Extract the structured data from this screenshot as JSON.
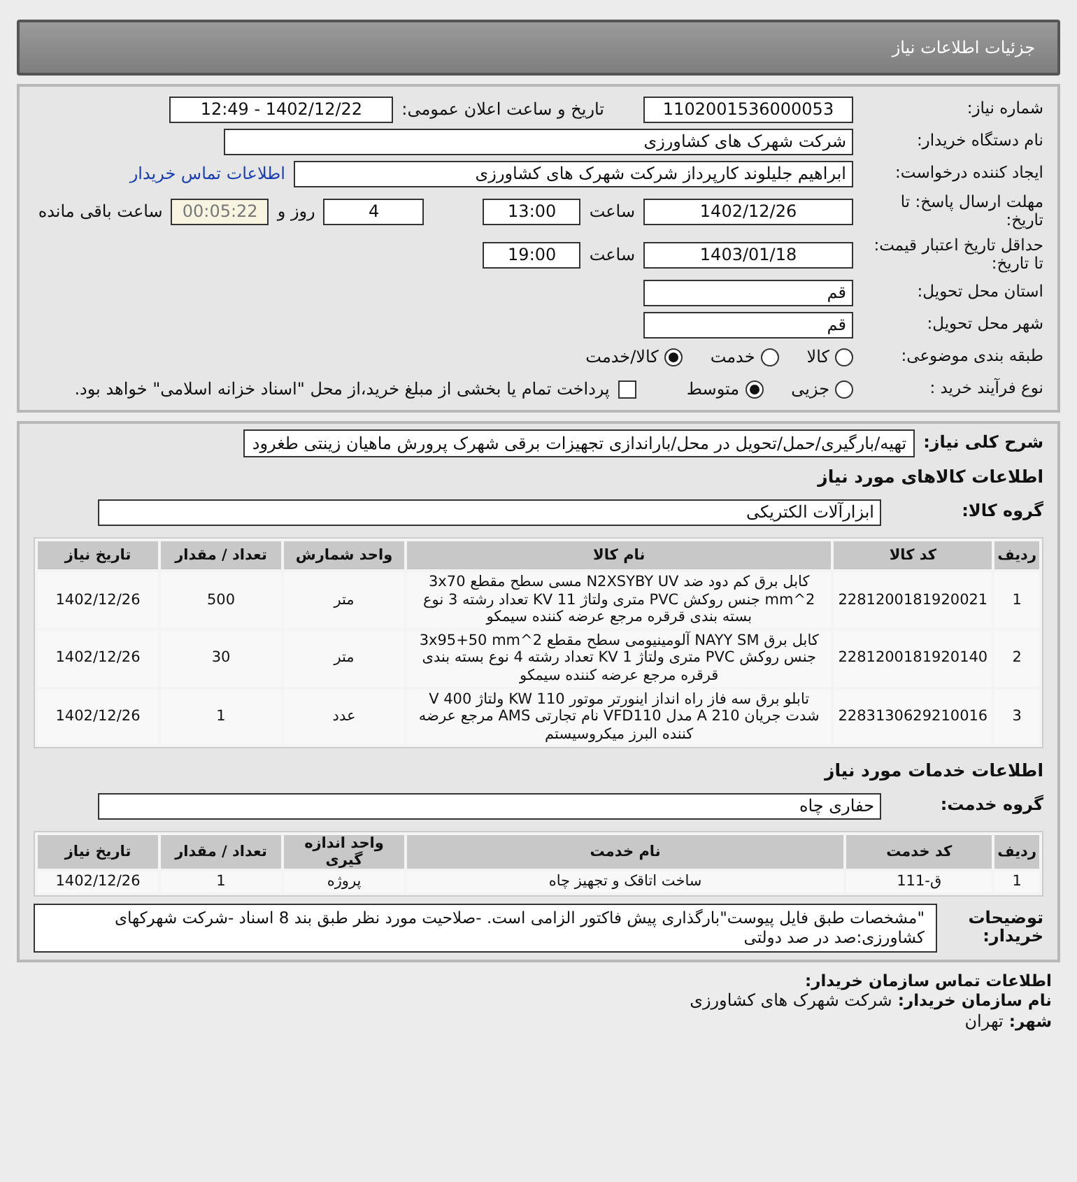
{
  "header": {
    "title": "جزئیات اطلاعات نیاز"
  },
  "need_info": {
    "need_number": {
      "label": "شماره نیاز:",
      "value": "1102001536000053"
    },
    "announce": {
      "label": "تاریخ و ساعت اعلان عمومی:",
      "value": "1402/12/22 - 12:49"
    },
    "buyer": {
      "label": "نام دستگاه خریدار:",
      "value": "شرکت شهرک های کشاورزی"
    },
    "requester": {
      "label": "ایجاد کننده درخواست:",
      "value": "ابراهیم جلیلوند کارپرداز شرکت شهرک های کشاورزی",
      "link": "اطلاعات تماس خریدار"
    },
    "deadline": {
      "label": "مهلت ارسال پاسخ: تا تاریخ:",
      "date": "1402/12/26",
      "time_label": "ساعت",
      "time": "13:00",
      "days": "4",
      "days_label": "روز و",
      "remaining": "00:05:22",
      "remaining_label": "ساعت باقی مانده"
    },
    "validity": {
      "label": "حداقل تاریخ اعتبار قیمت: تا تاریخ:",
      "date": "1403/01/18",
      "time_label": "ساعت",
      "time": "19:00"
    },
    "province": {
      "label": "استان محل تحویل:",
      "value": "قم"
    },
    "city": {
      "label": "شهر محل تحویل:",
      "value": "قم"
    },
    "category": {
      "label": "طبقه بندی موضوعی:",
      "options": [
        {
          "label": "کالا",
          "selected": false
        },
        {
          "label": "خدمت",
          "selected": false
        },
        {
          "label": "کالا/خدمت",
          "selected": true
        }
      ]
    },
    "purchase_process": {
      "label": "نوع فرآیند خرید :",
      "options": [
        {
          "label": "جزیی",
          "selected": false
        },
        {
          "label": "متوسط",
          "selected": true
        }
      ],
      "payment": {
        "label": "پرداخت تمام یا بخشی از مبلغ خرید،از محل \"اسناد خزانه اسلامی\" خواهد بود.",
        "checked": false
      }
    }
  },
  "details": {
    "description": {
      "label": "شرح کلی نیاز:",
      "value": "تهیه/بارگیری/حمل/تحویل در محل/باراندازی تجهیزات برقی شهرک پرورش ماهیان زینتی طغرود"
    },
    "goods": {
      "title": "اطلاعات کالاهای مورد نیاز",
      "group_label": "گروه کالا:",
      "group": "ابزارآلات الکتریکی",
      "columns": [
        "ردیف",
        "کد کالا",
        "نام کالا",
        "واحد شمارش",
        "تعداد / مقدار",
        "تاریخ نیاز"
      ],
      "rows": [
        [
          "1",
          "2281200181920021",
          "کابل برق کم دود ضد N2XSYBY UV مسی سطح مقطع 3x70 mm^2 جنس روکش PVC متری ولتاژ KV 11 تعداد رشته 3 نوع بسته بندی قرقره مرجع عرضه کننده سیمکو",
          "متر",
          "500",
          "1402/12/26"
        ],
        [
          "2",
          "2281200181920140",
          "کابل برق NAYY SM آلومینیومی سطح مقطع 3x95+50 mm^2 جنس روکش PVC متری ولتاژ KV 1 تعداد رشته 4 نوع بسته بندی قرقره مرجع عرضه کننده سیمکو",
          "متر",
          "30",
          "1402/12/26"
        ],
        [
          "3",
          "2283130629210016",
          "تابلو برق سه فاز راه انداز اینورتر موتور KW 110 ولتاژ V 400 شدت جریان A 210 مدل VFD110 نام تجارتی AMS مرجع عرضه کننده البرز میکروسیستم",
          "عدد",
          "1",
          "1402/12/26"
        ]
      ]
    },
    "services": {
      "title": "اطلاعات خدمات مورد نیاز",
      "group_label": "گروه خدمت:",
      "group": "حفاری چاه",
      "columns": [
        "ردیف",
        "کد خدمت",
        "نام خدمت",
        "واحد اندازه گیری",
        "تعداد / مقدار",
        "تاریخ نیاز"
      ],
      "rows": [
        [
          "1",
          "ق-111",
          "ساخت اتاقک و تجهیز چاه",
          "پروژه",
          "1",
          "1402/12/26"
        ]
      ]
    },
    "notes": {
      "label": "توضیحات خریدار:",
      "value": "\"مشخصات طبق فایل پیوست\"بارگذاری پیش فاکتور الزامی است. -صلاحیت مورد نظر طبق بند 8 اسناد -شرکت شهرکهای کشاورزی:صد در صد دولتی"
    }
  },
  "contact": {
    "title": "اطلاعات تماس سازمان خریدار:",
    "lines": [
      {
        "label": "نام سازمان خریدار:",
        "value": "شرکت شهرک های کشاورزی"
      },
      {
        "label": "شهر:",
        "value": "تهران"
      }
    ]
  }
}
